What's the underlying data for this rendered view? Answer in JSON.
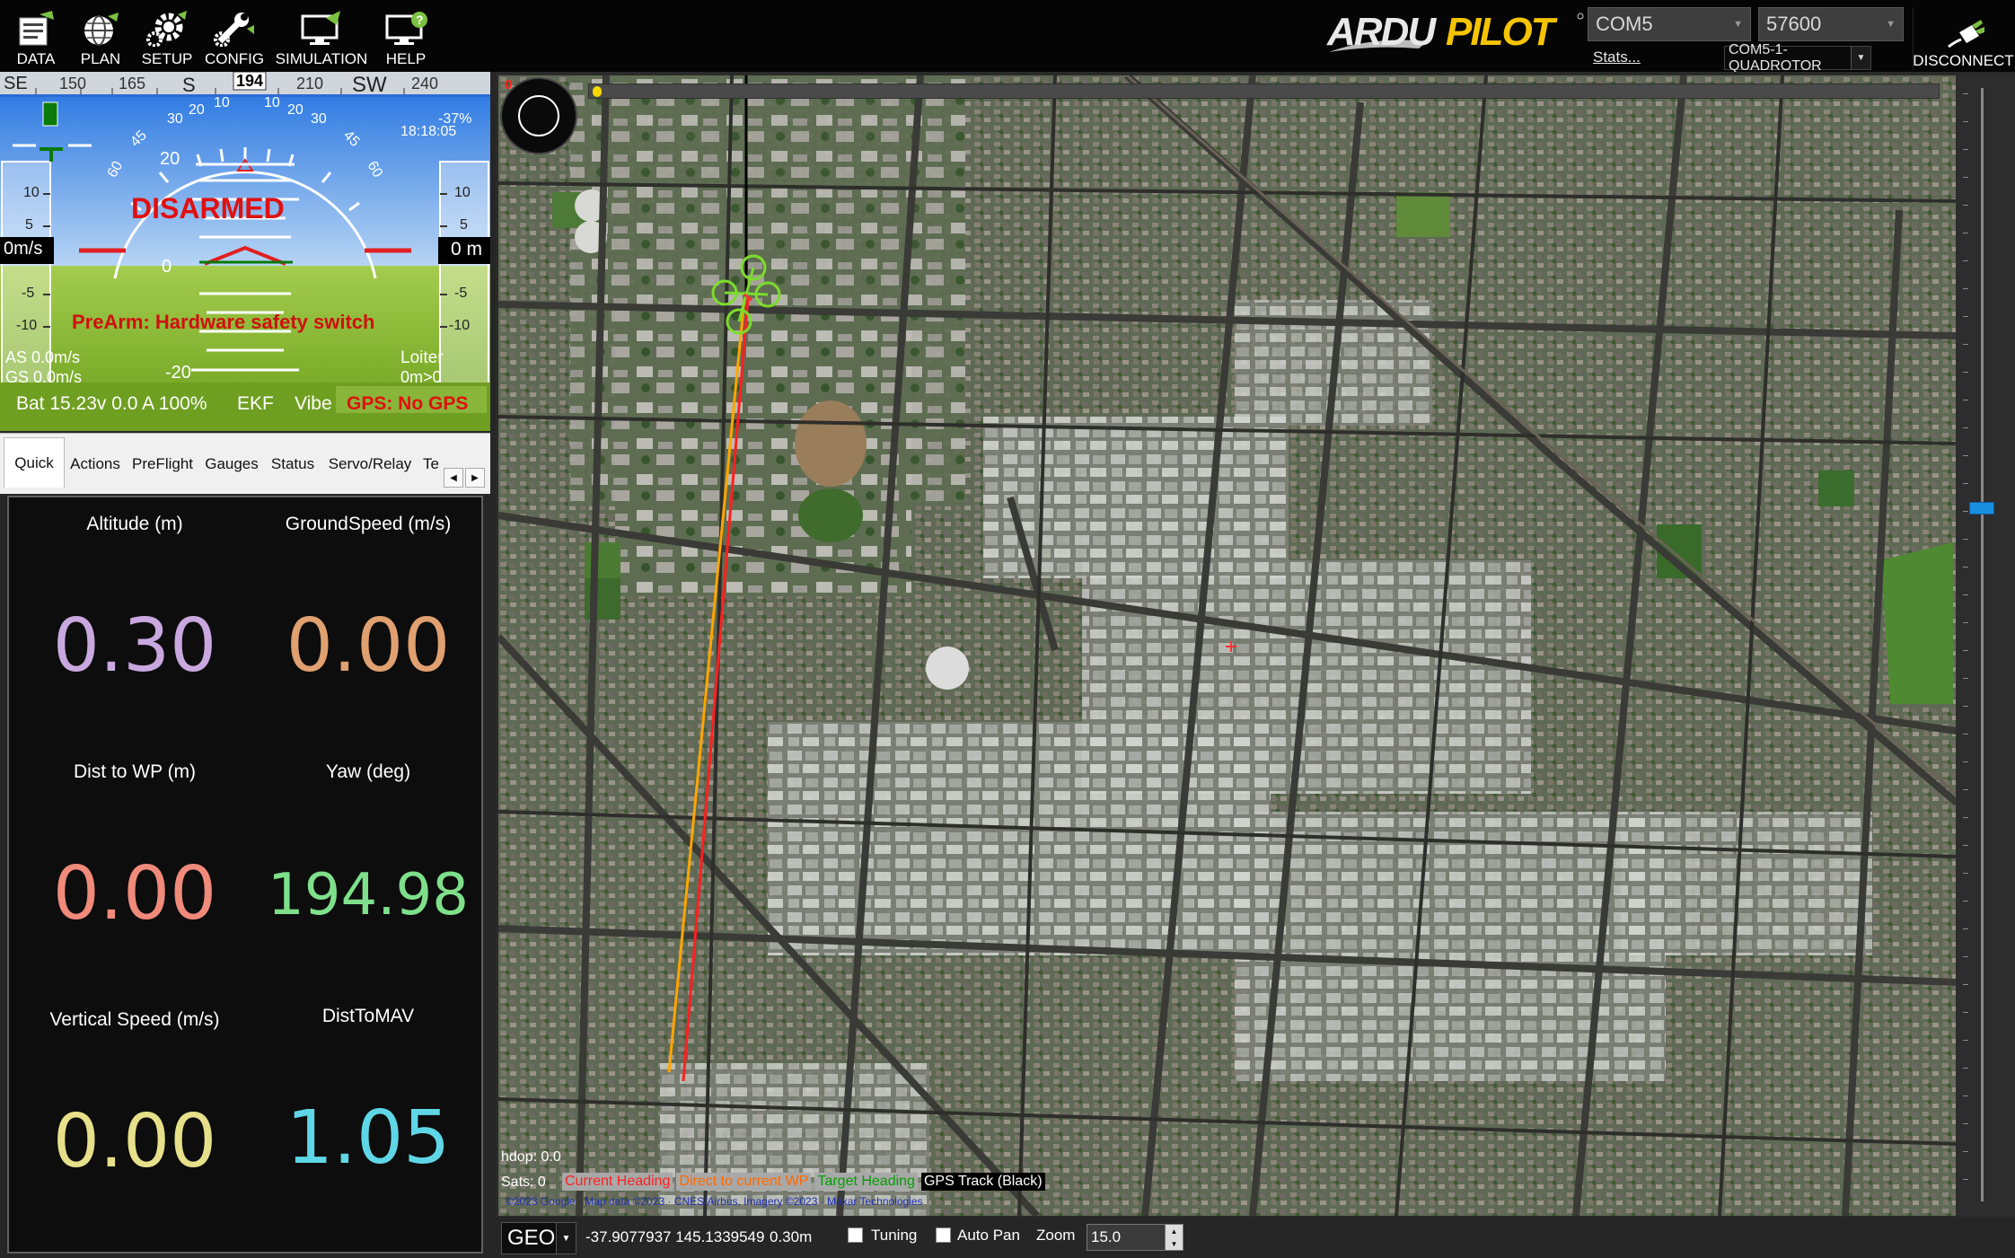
{
  "menu": {
    "data_label": "DATA",
    "plan_label": "PLAN",
    "setup_label": "SETUP",
    "config_label": "CONFIG",
    "simulation_label": "SIMULATION",
    "help_label": "HELP"
  },
  "brand": {
    "logo_text": "ARDUPILOT"
  },
  "connection": {
    "port": "COM5",
    "baud": "57600",
    "stats_link": "Stats...",
    "profile": "COM5-1-QUADROTOR",
    "disconnect_label": "DISCONNECT"
  },
  "hud": {
    "heading_ticks": [
      "SE",
      "150",
      "165",
      "S",
      "194",
      "210",
      "SW",
      "240"
    ],
    "heading_value": "194",
    "pitch_labels": [
      "10",
      "20",
      "30",
      "45",
      "60"
    ],
    "pitch_scale": [
      "20",
      "0",
      "-20"
    ],
    "speed_ticks": [
      "10",
      "5",
      "-5",
      "-10"
    ],
    "alt_ticks": [
      "10",
      "5",
      "-5",
      "-10"
    ],
    "speed_readout": "0m/s",
    "alt_readout": "0 m",
    "battery_pct_small": "-37%",
    "clock": "18:18:05",
    "armed_state": "DISARMED",
    "prearm_message": "PreArm: Hardware safety switch",
    "airspeed": "AS 0.0m/s",
    "groundspeed": "GS 0.0m/s",
    "mode": "Loiter",
    "wp_dist": "0m>0",
    "battery_line": "Bat 15.23v 0.0 A 100%",
    "ekf": "EKF",
    "vibe": "Vibe",
    "gps_status": "GPS: No GPS"
  },
  "tabs": [
    "Quick",
    "Actions",
    "PreFlight",
    "Gauges",
    "Status",
    "Servo/Relay",
    "Te"
  ],
  "quick": {
    "altitude_label": "Altitude (m)",
    "altitude_value": "0.30",
    "groundspeed_label": "GroundSpeed (m/s)",
    "groundspeed_value": "0.00",
    "dist_wp_label": "Dist to WP (m)",
    "dist_wp_value": "0.00",
    "yaw_label": "Yaw (deg)",
    "yaw_value": "194.98",
    "vspeed_label": "Vertical Speed (m/s)",
    "vspeed_value": "0.00",
    "distmav_label": "DistToMAV",
    "distmav_value": "1.05"
  },
  "map": {
    "progress_start": "0",
    "hdop": "hdop: 0.0",
    "sats": "Sats: 0",
    "legend_current": "Current Heading",
    "legend_direct": "Direct to current WP",
    "legend_target": "Target Heading",
    "legend_gps": "GPS Track (Black)",
    "copyright": "©2023 Google · Map data ©2023 · CNES/Airbus, Imagery ©2023 · Maxar Technologies"
  },
  "statusbar": {
    "coord_system": "GEO",
    "coordinates": "-37.9077937 145.1339549",
    "altitude": "0.30m",
    "tuning_label": "Tuning",
    "autopan_label": "Auto Pan",
    "zoom_label": "Zoom",
    "zoom_value": "15.0"
  },
  "colors": {
    "altitude": "#c9a8e0",
    "groundspeed": "#e0a070",
    "dist_wp": "#f08a7a",
    "yaw": "#7ee08a",
    "vspeed": "#e6e08a",
    "distmav": "#5fd6e6",
    "current_heading": "#ff2020",
    "direct_wp": "#ffa500",
    "target_heading": "#00c000"
  }
}
